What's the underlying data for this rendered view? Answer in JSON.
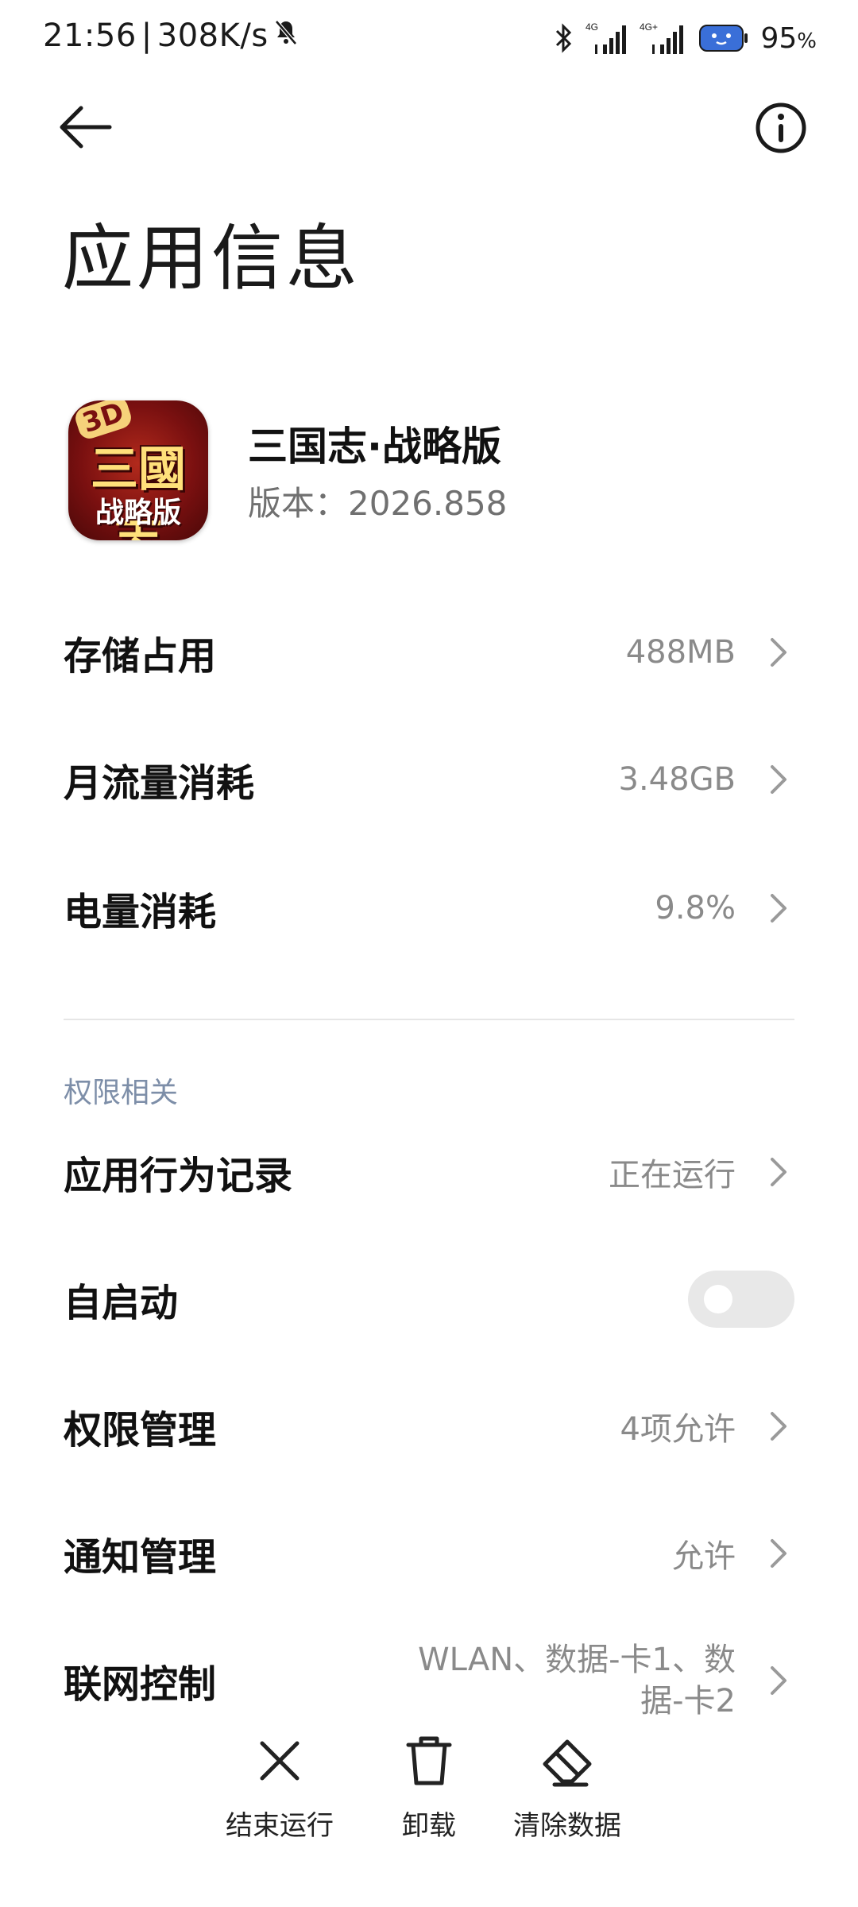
{
  "status_bar": {
    "time": "21:56",
    "net_speed": "308K/s",
    "battery_percent": "95",
    "battery_unit": "%",
    "signal1_label": "4G",
    "signal2_label": "4G+"
  },
  "header": {
    "title": "应用信息"
  },
  "app": {
    "name": "三国志·战略版",
    "version": "版本：2026.858",
    "icon_text_3d": "3D",
    "icon_text_main": "三國志",
    "icon_text_sub": "战略版"
  },
  "usage_rows": [
    {
      "label": "存储占用",
      "value": "488MB"
    },
    {
      "label": "月流量消耗",
      "value": "3.48GB"
    },
    {
      "label": "电量消耗",
      "value": "9.8%"
    }
  ],
  "permissions_section": {
    "header": "权限相关",
    "behavior": {
      "label": "应用行为记录",
      "value": "正在运行"
    },
    "autostart": {
      "label": "自启动",
      "enabled": false
    },
    "permission_mgmt": {
      "label": "权限管理",
      "value": "4项允许"
    },
    "notification_mgmt": {
      "label": "通知管理",
      "value": "允许"
    },
    "network_control": {
      "label": "联网控制",
      "value": "WLAN、数据-卡1、数据-卡2"
    }
  },
  "bottom_actions": {
    "stop": "结束运行",
    "uninstall": "卸载",
    "clear_data": "清除数据"
  }
}
